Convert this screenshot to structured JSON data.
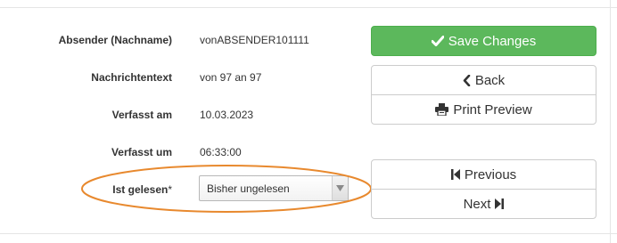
{
  "form": {
    "fields": [
      {
        "label": "Absender (Nachname)",
        "value": "vonABSENDER101111"
      },
      {
        "label": "Nachrichtentext",
        "value": "von 97 an 97"
      },
      {
        "label": "Verfasst am",
        "value": "10.03.2023"
      },
      {
        "label": "Verfasst um",
        "value": "06:33:00"
      }
    ],
    "read_status": {
      "label": "Ist gelesen",
      "required_marker": "*",
      "selected": "Bisher ungelesen"
    }
  },
  "actions": {
    "save_label": "Save Changes",
    "back_label": "Back",
    "print_label": "Print Preview",
    "previous_label": "Previous",
    "next_label": "Next"
  },
  "colors": {
    "save_button": "#5cb85c",
    "highlight_ellipse": "#e8892e"
  },
  "icons": {
    "save": "checkmark-icon",
    "back": "chevron-left-icon",
    "print": "printer-icon",
    "previous": "step-backward-icon",
    "next": "step-forward-icon",
    "select": "triangle-down-icon"
  }
}
